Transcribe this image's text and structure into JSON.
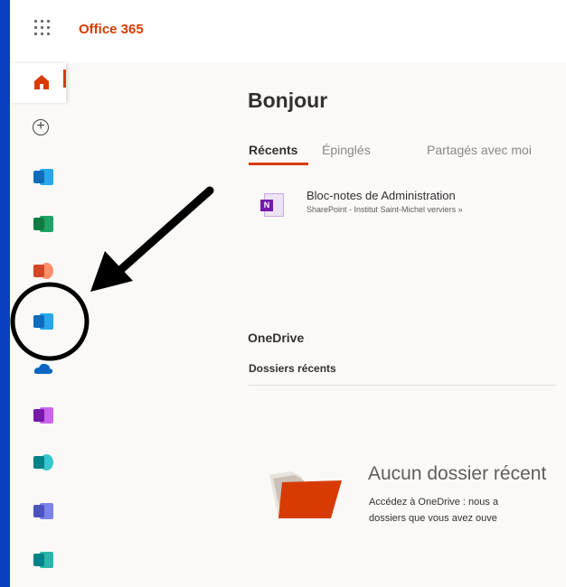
{
  "app": {
    "brand": "Office 365"
  },
  "main": {
    "greeting": "Bonjour",
    "tabs": [
      {
        "label": "Récents",
        "active": true
      },
      {
        "label": "Épinglés",
        "active": false
      },
      {
        "label": "Partagés avec moi",
        "active": false
      }
    ],
    "recent_file": {
      "name": "Bloc-notes de Administration",
      "path": "SharePoint - Institut Saint-Michel verviers »",
      "icon": "onenote-icon"
    }
  },
  "onedrive": {
    "title": "OneDrive",
    "subtitle": "Dossiers récents",
    "empty_title": "Aucun dossier récent",
    "empty_desc_line1": "Accédez à OneDrive : nous a",
    "empty_desc_line2": "dossiers que vous avez ouve"
  },
  "rail": [
    {
      "name": "home-icon"
    },
    {
      "name": "create-icon"
    },
    {
      "name": "outlook-icon",
      "color": "#0f6cbd"
    },
    {
      "name": "excel-icon",
      "color": "#107c41"
    },
    {
      "name": "powerpoint-icon",
      "color": "#d24726"
    },
    {
      "name": "outlook-icon",
      "color": "#0f6cbd"
    },
    {
      "name": "onedrive-icon",
      "color": "#0a66c2"
    },
    {
      "name": "onenote-icon",
      "color": "#7719aa"
    },
    {
      "name": "sharepoint-icon",
      "color": "#038387"
    },
    {
      "name": "teams-icon",
      "color": "#4b53bc"
    },
    {
      "name": "sway-icon",
      "color": "#038387"
    }
  ],
  "colors": {
    "accent": "#d83b01",
    "left_bar": "#0b3fc2",
    "annotation": "#000000"
  }
}
